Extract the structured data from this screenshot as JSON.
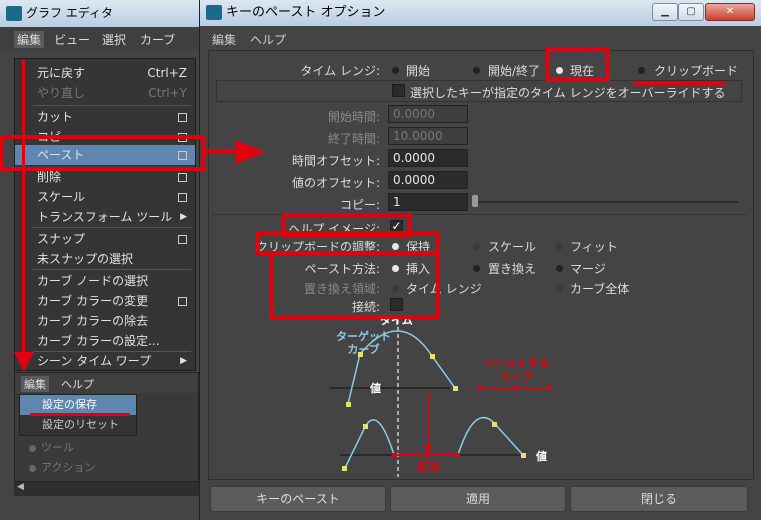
{
  "graph_editor": {
    "title": "グラフ エディタ",
    "menubar": [
      "編集",
      "ビュー",
      "選択",
      "カーブ"
    ],
    "menu_items": [
      {
        "label": "元に戻す",
        "shortcut": "Ctrl+Z"
      },
      {
        "label": "やり直し",
        "shortcut": "Ctrl+Y"
      },
      {
        "label": "カット"
      },
      {
        "label": "コピー"
      },
      {
        "label": "ペースト"
      },
      {
        "label": "削除"
      },
      {
        "label": "スケール"
      },
      {
        "label": "トランスフォーム ツール"
      },
      {
        "label": "スナップ"
      },
      {
        "label": "未スナップの選択"
      },
      {
        "label": "カーブ ノードの選択"
      },
      {
        "label": "カーブ カラーの変更"
      },
      {
        "label": "カーブ カラーの除去"
      },
      {
        "label": "カーブ カラーの設定..."
      },
      {
        "label": "シーン タイム ワープ"
      }
    ],
    "options_menubar": [
      "編集",
      "ヘルプ"
    ],
    "options_items": [
      "設定の保存",
      "設定のリセット"
    ],
    "tool_labels": [
      "ツール",
      "アクション"
    ]
  },
  "dialog": {
    "title": "キーのペースト オプション",
    "menubar": [
      "編集",
      "ヘルプ"
    ],
    "time_range": {
      "label": "タイム レンジ:",
      "options": [
        "開始",
        "開始/終了",
        "現在",
        "クリップボード"
      ],
      "selected": "現在"
    },
    "override_label": "選択したキーが指定のタイム レンジをオーバーライドする",
    "start_time": {
      "label": "開始時間:",
      "value": "0.0000"
    },
    "end_time": {
      "label": "終了時間:",
      "value": "10.0000"
    },
    "time_offset": {
      "label": "時間オフセット:",
      "value": "0.0000"
    },
    "value_offset": {
      "label": "値のオフセット:",
      "value": "0.0000"
    },
    "copies": {
      "label": "コピー:",
      "value": "1"
    },
    "help_image": {
      "label": "ヘルプ イメージ:"
    },
    "clipboard_adjust": {
      "label": "クリップボードの調整:",
      "options": [
        "保持",
        "スケール",
        "フィット"
      ],
      "selected": "保持"
    },
    "paste_method": {
      "label": "ペースト方法:",
      "options": [
        "挿入",
        "置き換え",
        "マージ"
      ],
      "selected": "挿入"
    },
    "replace_region": {
      "label": "置き換え領域:",
      "options": [
        "タイム レンジ",
        "カーブ全体"
      ]
    },
    "connect": {
      "label": "接続:"
    },
    "diagram": {
      "time": "タイム",
      "target_curve": "ターゲット\nカーブ",
      "paste_curve": "ペーストする\nカーブ",
      "value": "値",
      "result": "結果"
    },
    "buttons": [
      "キーのペースト",
      "適用",
      "閉じる"
    ]
  },
  "colors": {
    "accent": "#e00010",
    "curve": "#8fc8e8"
  }
}
